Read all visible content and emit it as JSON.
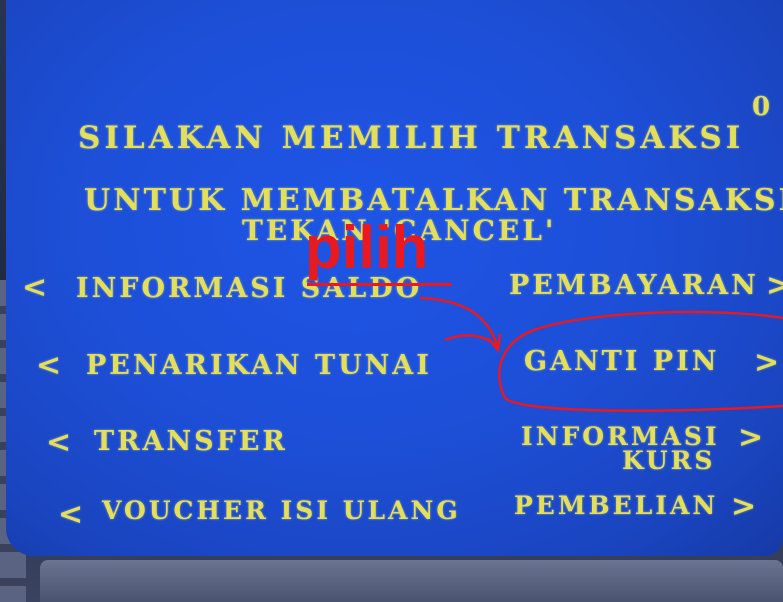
{
  "screen": {
    "corner_text": "0",
    "title": "SILAKAN  MEMILIH TRANSAKSI",
    "subtitle_line1": "UNTUK MEMBATALKAN TRANSAKSI",
    "subtitle_line2": "TEKAN 'CANCEL'"
  },
  "left_options": [
    {
      "label": "INFORMASI SALDO",
      "arrow": "<"
    },
    {
      "label": "PENARIKAN TUNAI",
      "arrow": "<"
    },
    {
      "label": "TRANSFER",
      "arrow": "<"
    },
    {
      "label": "VOUCHER ISI ULANG",
      "arrow": "<"
    }
  ],
  "right_options": [
    {
      "label": "PEMBAYARAN",
      "arrow": ">"
    },
    {
      "label": "GANTI PIN",
      "arrow": ">"
    },
    {
      "label_line1": "INFORMASI",
      "label_line2": "KURS",
      "arrow": ">"
    },
    {
      "label": "PEMBELIAN",
      "arrow": ">"
    }
  ],
  "annotation": {
    "text": "pilih",
    "color": "#e8191f",
    "highlighted_option": "GANTI PIN"
  },
  "colors": {
    "screen_blue": "#1d4fd8",
    "text_yellow": "#e3df5a"
  }
}
